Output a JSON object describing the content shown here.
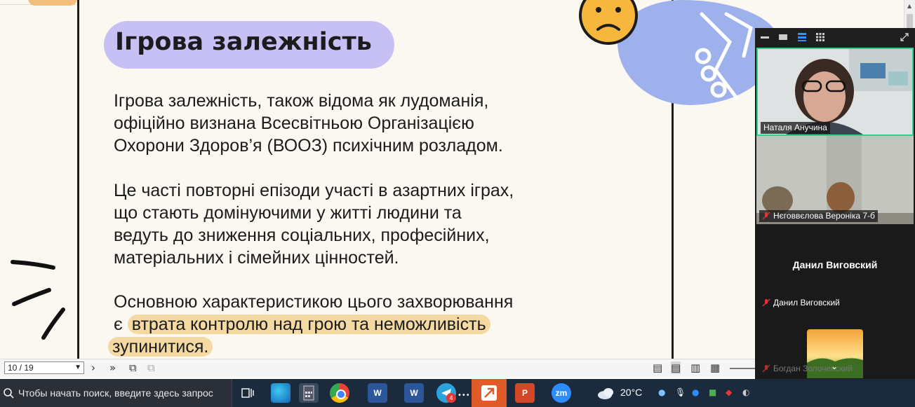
{
  "slide": {
    "title": "Ігрова залежність",
    "paragraph1": [
      "Ігрова залежність, також відома як лудоманія,",
      "офіційно визнана Всесвітньою Організацією",
      "Охорони Здоров’я (ВООЗ) психічним розладом."
    ],
    "paragraph2": [
      "Це часті повторні епізоди участі в азартних іграх,",
      "що стають домінуючими у житті людини та",
      "ведуть до зниження соціальних, професійних,",
      "матеріальних і сімейних цінностей."
    ],
    "paragraph3_line1": "Основною характеристикою цього захворювання",
    "paragraph3_line2_prefix": "є",
    "paragraph3_line2_highlight": "втрата контролю над грою та неможливість",
    "paragraph3_line3_highlight": "зупинитися.",
    "colors": {
      "title_pill": "#c6c0f5",
      "highlight": "#f5d9a3",
      "blob": "#9fb1ec"
    }
  },
  "pdf_toolbar": {
    "page_value": "10 / 19"
  },
  "zoom": {
    "participants": [
      {
        "name": "Наталя Анучина",
        "active": true
      },
      {
        "name": "Нєговвєлова Вероніка 7-б",
        "muted": true
      },
      {
        "name": "Данил Виговский",
        "muted": true,
        "display_name": "Данил Виговский"
      },
      {
        "name": "Богдан Золочевский",
        "muted": true
      }
    ]
  },
  "taskbar": {
    "search_placeholder": "Чтобы начать поиск, введите здесь запрос",
    "weather": "20°C",
    "telegram_badge": "4",
    "word_label": "W",
    "ppt_label": "P",
    "zoom_label": "zm"
  }
}
